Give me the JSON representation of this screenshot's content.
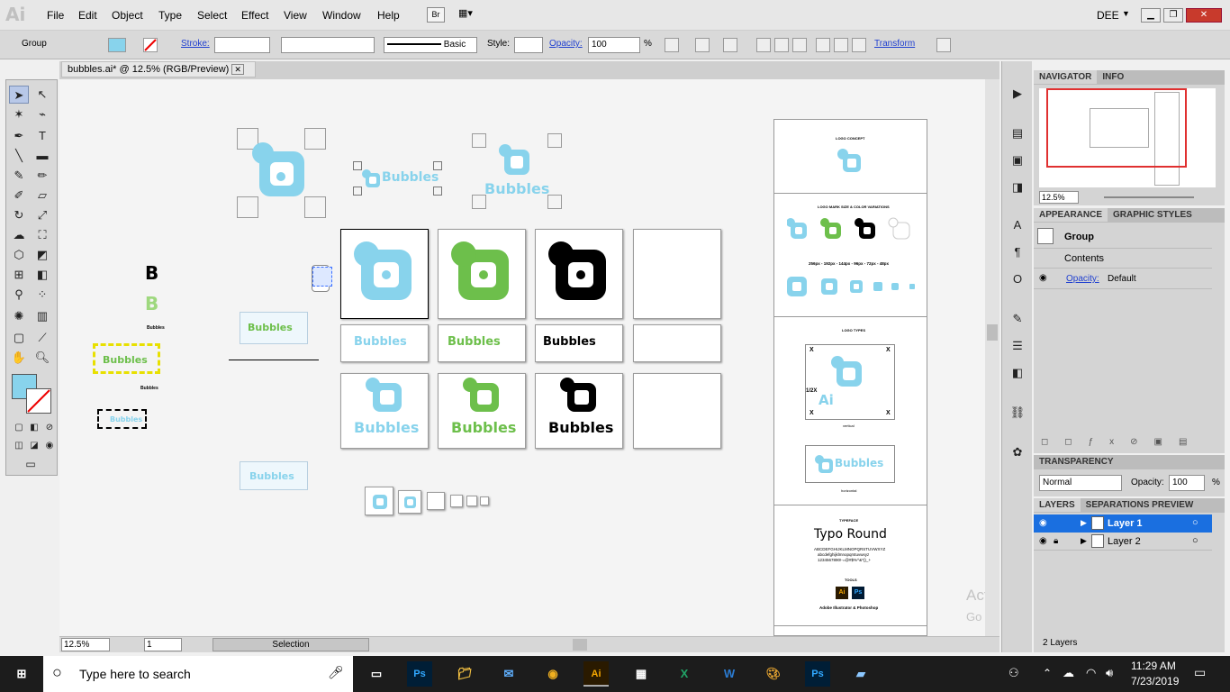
{
  "app": {
    "icon_label": "Ai",
    "menus": [
      "File",
      "Edit",
      "Object",
      "Type",
      "Select",
      "Effect",
      "View",
      "Window",
      "Help"
    ],
    "bridge_label": "Br",
    "workspace": "DEE"
  },
  "control": {
    "selection": "Group",
    "stroke_label": "Stroke:",
    "style_label": "Style:",
    "brush": "Basic",
    "opacity_label": "Opacity:",
    "opacity_value": "100",
    "percent": "%",
    "transform_label": "Transform"
  },
  "document": {
    "tab_title": "bubbles.ai* @ 12.5% (RGB/Preview)",
    "zoom": "12.5%",
    "page": "1",
    "status": "Selection"
  },
  "artboard": {
    "bubbles": "Bubbles",
    "right_sheet": {
      "concept": "LOGO CONCEPT",
      "sizes": "LOGO MARK SIZE & COLOR VARIATIONS",
      "px": "256px - 192px - 144px - 96px - 72px - 48px",
      "types": "LOGO TYPES",
      "vertical": "vertical",
      "horizontal": "horizontal",
      "ratio": "1/2X",
      "x": "X",
      "typeface": "TYPEFACE",
      "typo": "Typo Round",
      "alphabet1": "ABCDEFGHIJKLMNOPQRSTUVWXYZ",
      "alphabet2": "abcdefghijklmnopqrstuvwxyz",
      "digits": "1234567890!-=@#$%^&*()_+",
      "tools": "TOOLS",
      "ai": "Ai",
      "ps": "Ps",
      "tools_caption": "Adobe Illustrator & Photoshop"
    }
  },
  "navigator": {
    "tabs": [
      "NAVIGATOR",
      "INFO"
    ],
    "zoom": "12.5%"
  },
  "appearance": {
    "tabs": [
      "APPEARANCE",
      "GRAPHIC STYLES"
    ],
    "group": "Group",
    "contents": "Contents",
    "opacity_label": "Opacity:",
    "opacity_value": "Default"
  },
  "transparency": {
    "title": "TRANSPARENCY",
    "blend": "Normal",
    "opacity_label": "Opacity:",
    "opacity_value": "100",
    "percent": "%"
  },
  "layers": {
    "tabs": [
      "LAYERS",
      "SEPARATIONS PREVIEW"
    ],
    "items": [
      {
        "name": "Layer 1",
        "color": "#3b7bff"
      },
      {
        "name": "Layer 2",
        "color": "#ff4040"
      }
    ],
    "count": "2 Layers"
  },
  "watermark": {
    "line1": "Activate Windows",
    "line2": "Go to Settings to activate Windows."
  },
  "taskbar": {
    "search": "Type here to search",
    "time": "11:29 AM",
    "date": "7/23/2019",
    "apps": [
      "Ps",
      "Ai",
      "W",
      "Ps"
    ]
  },
  "colors": {
    "blue": "#88d3ec",
    "green": "#6dbf4b",
    "selection": "#1a6fe0"
  }
}
